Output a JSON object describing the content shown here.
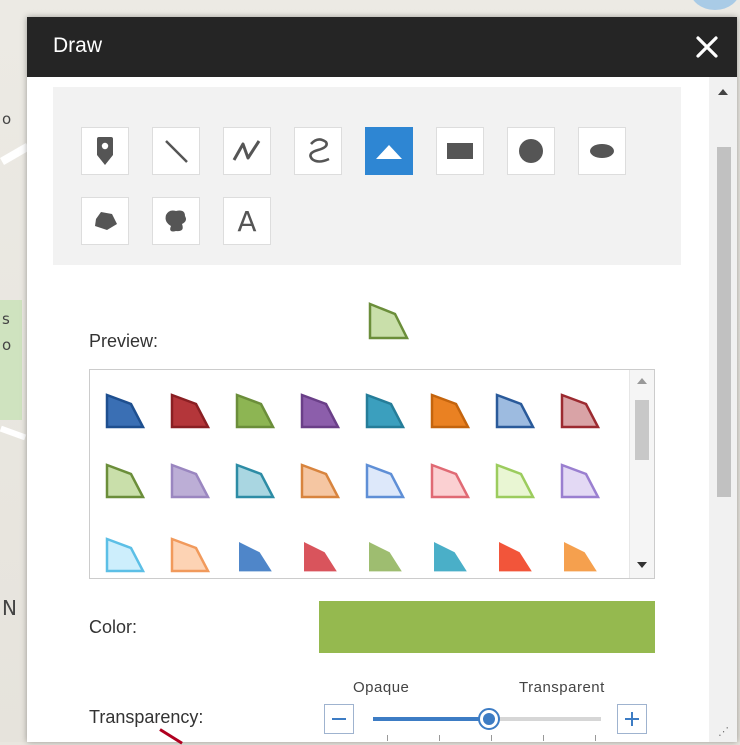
{
  "window": {
    "title": "Draw",
    "close_icon": "close-icon"
  },
  "tools": [
    {
      "name": "point",
      "icon": "map-pin-icon",
      "active": false
    },
    {
      "name": "line",
      "icon": "line-icon",
      "active": false
    },
    {
      "name": "polyline",
      "icon": "polyline-icon",
      "active": false
    },
    {
      "name": "freehand-line",
      "icon": "freehand-line-icon",
      "active": false
    },
    {
      "name": "triangle",
      "icon": "triangle-icon",
      "active": true
    },
    {
      "name": "rectangle",
      "icon": "rectangle-icon",
      "active": false
    },
    {
      "name": "circle",
      "icon": "circle-icon",
      "active": false
    },
    {
      "name": "ellipse",
      "icon": "ellipse-icon",
      "active": false
    },
    {
      "name": "polygon",
      "icon": "polygon-icon",
      "active": false
    },
    {
      "name": "freehand-polygon",
      "icon": "freehand-polygon-icon",
      "active": false
    },
    {
      "name": "text",
      "icon": "text-icon",
      "label": "A",
      "active": false
    }
  ],
  "preview": {
    "label": "Preview:",
    "fill": "#c9dfaa",
    "stroke": "#6b8e3a"
  },
  "symbols": [
    [
      {
        "fill": "#3a6fb4",
        "stroke": "#1e4f8f"
      },
      {
        "fill": "#b4363a",
        "stroke": "#8a1f23"
      },
      {
        "fill": "#8db553",
        "stroke": "#6b8e3a"
      },
      {
        "fill": "#8c5eab",
        "stroke": "#6a3f88"
      },
      {
        "fill": "#3b9fbe",
        "stroke": "#257d99"
      },
      {
        "fill": "#ea8122",
        "stroke": "#c4640d"
      },
      {
        "fill": "#9dbbe0",
        "stroke": "#2a5a9a"
      },
      {
        "fill": "#d9a3a6",
        "stroke": "#9c2a30"
      }
    ],
    [
      {
        "fill": "#c9dfaa",
        "stroke": "#6b8e3a"
      },
      {
        "fill": "#bcaed6",
        "stroke": "#9a86c0"
      },
      {
        "fill": "#a9d6e1",
        "stroke": "#2d8ca5"
      },
      {
        "fill": "#f5c6a2",
        "stroke": "#d8843e"
      },
      {
        "fill": "#dde8fa",
        "stroke": "#5f8fd6"
      },
      {
        "fill": "#fbd0d2",
        "stroke": "#e06a74"
      },
      {
        "fill": "#e9f6d3",
        "stroke": "#9ccc5e"
      },
      {
        "fill": "#e3d9f4",
        "stroke": "#9a7fd0"
      }
    ],
    [
      {
        "fill": "#cdeefc",
        "stroke": "#5cbfe6"
      },
      {
        "fill": "#fdd3b4",
        "stroke": "#f19a5c"
      },
      {
        "fill": "#4f86c9",
        "stroke": "#4f86c9"
      },
      {
        "fill": "#d9545c",
        "stroke": "#d9545c"
      },
      {
        "fill": "#9ebd70",
        "stroke": "#9ebd70"
      },
      {
        "fill": "#4aafc8",
        "stroke": "#4aafc8"
      },
      {
        "fill": "#f2553a",
        "stroke": "#f2553a"
      },
      {
        "fill": "#f5a04e",
        "stroke": "#f5a04e"
      }
    ]
  ],
  "color": {
    "label": "Color:",
    "value": "#95b94f"
  },
  "transparency": {
    "label": "Transparency:",
    "min_label": "Opaque",
    "max_label": "Transparent",
    "value_fraction": 0.51,
    "decrease_icon": "minus-icon",
    "increase_icon": "plus-icon"
  },
  "colors": {
    "title_bar": "#252525",
    "accent": "#2e86d3",
    "slider": "#3d7cc4"
  }
}
